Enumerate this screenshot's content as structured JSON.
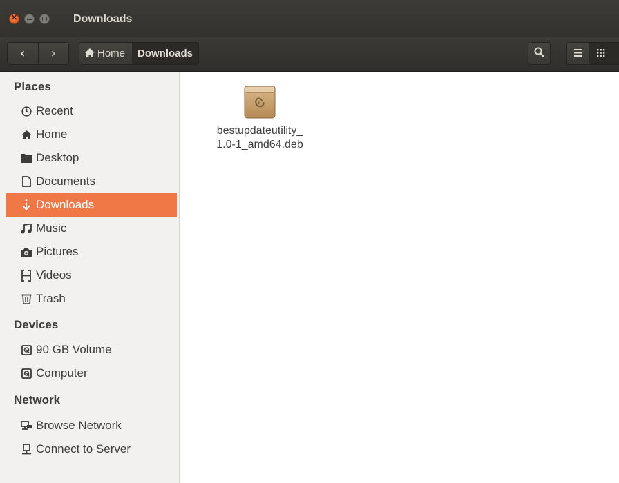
{
  "window": {
    "title": "Downloads"
  },
  "toolbar": {
    "back_icon": "chevron-left-icon",
    "forward_icon": "chevron-right-icon",
    "breadcrumbs": [
      {
        "label": "Home",
        "icon": "home-icon"
      },
      {
        "label": "Downloads"
      }
    ]
  },
  "sidebar": {
    "sections": [
      {
        "title": "Places",
        "items": [
          {
            "label": "Recent",
            "icon": "clock-icon"
          },
          {
            "label": "Home",
            "icon": "home-icon"
          },
          {
            "label": "Desktop",
            "icon": "folder-icon"
          },
          {
            "label": "Documents",
            "icon": "document-icon"
          },
          {
            "label": "Downloads",
            "icon": "download-icon",
            "selected": true
          },
          {
            "label": "Music",
            "icon": "music-icon"
          },
          {
            "label": "Pictures",
            "icon": "camera-icon"
          },
          {
            "label": "Videos",
            "icon": "film-icon"
          },
          {
            "label": "Trash",
            "icon": "trash-icon"
          }
        ]
      },
      {
        "title": "Devices",
        "items": [
          {
            "label": "90 GB Volume",
            "icon": "drive-icon"
          },
          {
            "label": "Computer",
            "icon": "drive-icon"
          }
        ]
      },
      {
        "title": "Network",
        "items": [
          {
            "label": "Browse Network",
            "icon": "network-icon"
          },
          {
            "label": "Connect to Server",
            "icon": "server-icon"
          }
        ]
      }
    ]
  },
  "files": [
    {
      "name_line1": "bestupdateutility_",
      "name_line2": "1.0-1_amd64.deb",
      "icon": "debian-package-icon"
    }
  ],
  "colors": {
    "accent": "#f07746",
    "titlebar": "#3c3b37",
    "sidebar_bg": "#f2f1f0"
  }
}
